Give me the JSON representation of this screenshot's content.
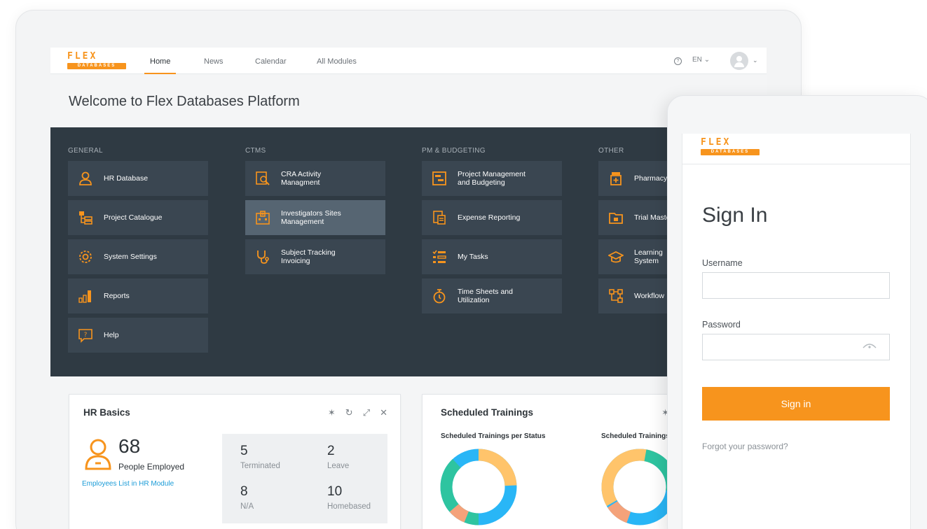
{
  "app": {
    "logo_top": "FLEX",
    "logo_bottom": "DATABASES",
    "welcome": "Welcome to Flex Databases Platform"
  },
  "nav": {
    "tabs": [
      "Home",
      "News",
      "Calendar",
      "All Modules"
    ],
    "active_tab": "Home",
    "help_icon": "?",
    "language": "EN",
    "chevron": "⌄"
  },
  "modules": {
    "general": {
      "title": "GENERAL",
      "items": [
        "HR Database",
        "Project Catalogue",
        "System Settings",
        "Reports",
        "Help"
      ]
    },
    "ctms": {
      "title": "CTMS",
      "items": [
        "CRA Activity\nManagment",
        "Investigators Sites\nManagement",
        "Subject Tracking\nInvoicing"
      ]
    },
    "pm": {
      "title": "PM & BUDGETING",
      "items": [
        "Project Management\nand Budgeting",
        "Expense Reporting",
        "My Tasks",
        "Time Sheets and\nUtilization"
      ]
    },
    "other": {
      "title": "OTHER",
      "items": [
        "Pharmacy",
        "Trial Master",
        "Learning\nSystem",
        "Workflow"
      ]
    }
  },
  "hr_basics": {
    "title": "HR Basics",
    "employed_count": "68",
    "employed_label": "People Employed",
    "link": "Employees List in HR Module",
    "stats": [
      {
        "value": "5",
        "label": "Terminated"
      },
      {
        "value": "2",
        "label": "Leave"
      },
      {
        "value": "8",
        "label": "N/A"
      },
      {
        "value": "10",
        "label": "Homebased"
      }
    ],
    "tools": [
      "✶",
      "↻",
      "⤢",
      "✕"
    ]
  },
  "trainings": {
    "title": "Scheduled Trainings",
    "chart1_title": "Scheduled Trainings per Status",
    "chart2_title": "Scheduled Trainings",
    "pin": "✶"
  },
  "signin": {
    "title": "Sign In",
    "username_label": "Username",
    "username_value": "",
    "password_label": "Password",
    "password_value": "",
    "button": "Sign in",
    "forgot": "Forgot your password?"
  },
  "colors": {
    "accent": "#f7941d",
    "dark_panel": "#2f3a43",
    "tile": "#3a4651",
    "link": "#1a9bd7",
    "donut_green": "#2ec4a0",
    "donut_blue": "#29b6f6",
    "donut_yellow": "#ffc46b",
    "donut_salmon": "#f4a27a"
  }
}
